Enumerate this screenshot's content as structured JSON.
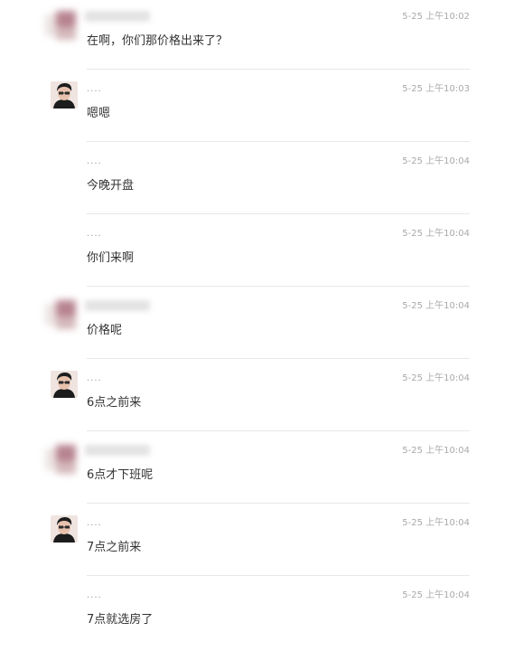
{
  "messages": [
    {
      "sender": "other",
      "name": "",
      "time": "5-25 上午10:02",
      "text": "在啊，你们那价格出来了？"
    },
    {
      "sender": "agent",
      "name": "....",
      "time": "5-25 上午10:03",
      "text": "嗯嗯"
    },
    {
      "sender": "agent",
      "name": "....",
      "time": "5-25 上午10:04",
      "text": "今晚开盘"
    },
    {
      "sender": "agent",
      "name": "....",
      "time": "5-25 上午10:04",
      "text": "你们来啊"
    },
    {
      "sender": "other",
      "name": "",
      "time": "5-25 上午10:04",
      "text": "价格呢"
    },
    {
      "sender": "agent",
      "name": "....",
      "time": "5-25 上午10:04",
      "text": "6点之前来"
    },
    {
      "sender": "other",
      "name": "",
      "time": "5-25 上午10:04",
      "text": "6点才下班呢"
    },
    {
      "sender": "agent",
      "name": "....",
      "time": "5-25 上午10:04",
      "text": "7点之前来"
    },
    {
      "sender": "agent",
      "name": "....",
      "time": "5-25 上午10:04",
      "text": "7点就选房了"
    }
  ],
  "avatar_visibility": [
    true,
    true,
    false,
    false,
    true,
    true,
    true,
    true,
    false
  ]
}
